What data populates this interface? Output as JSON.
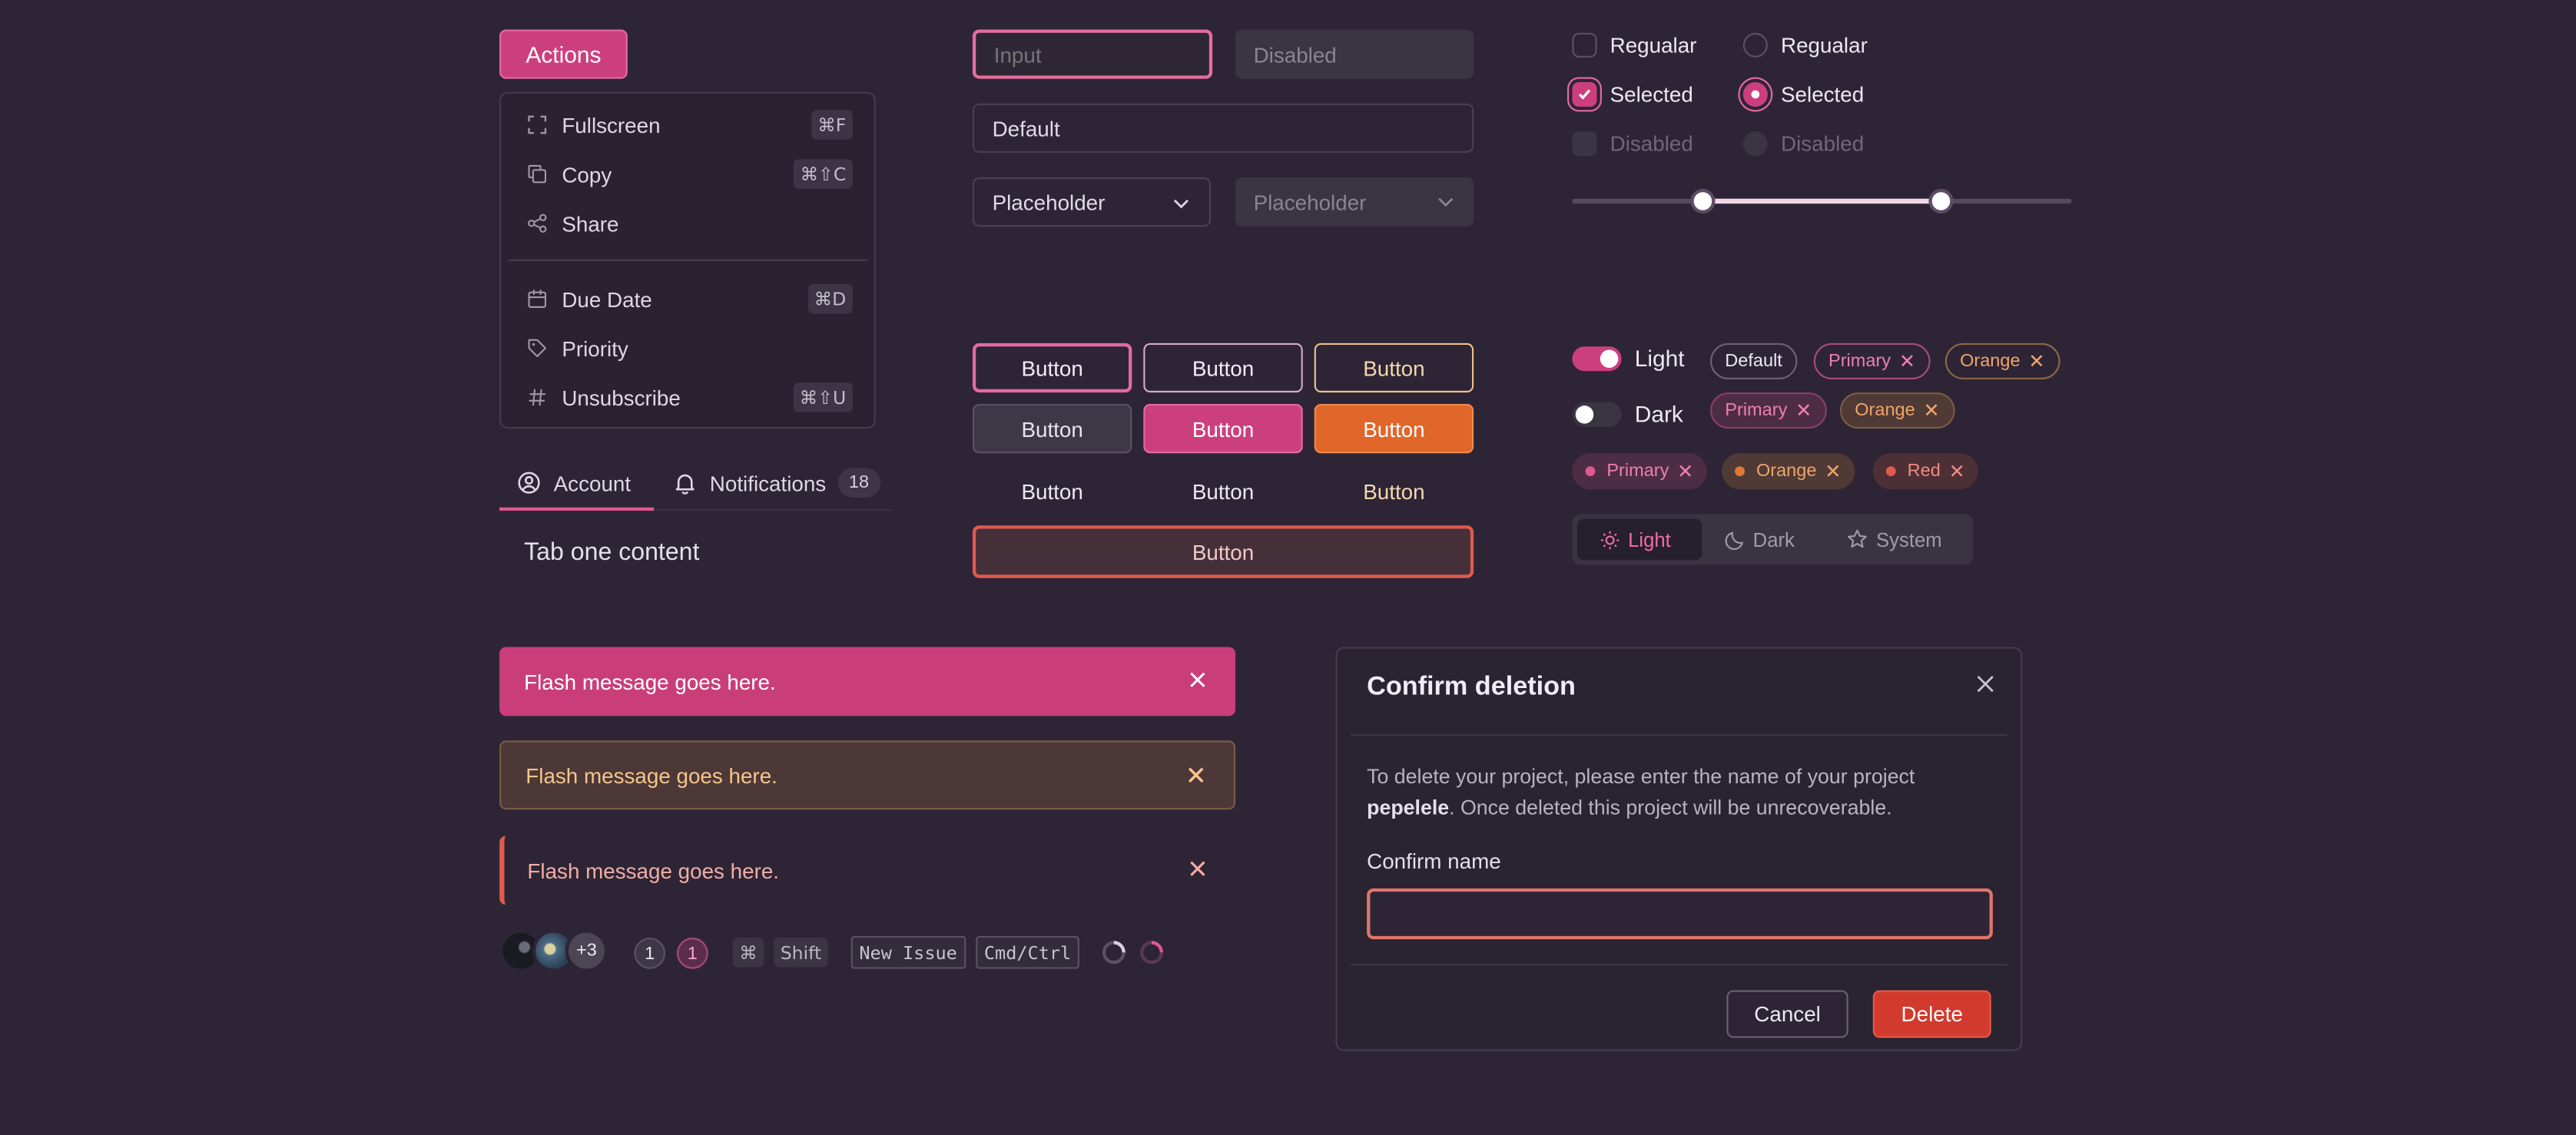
{
  "menu": {
    "trigger_label": "Actions",
    "items": [
      {
        "label": "Fullscreen",
        "icon": "expand-icon",
        "shortcut": "⌘F"
      },
      {
        "label": "Copy",
        "icon": "copy-icon",
        "shortcut": "⌘⇧C"
      },
      {
        "label": "Share",
        "icon": "share-icon",
        "shortcut": ""
      },
      {
        "label": "Due Date",
        "icon": "calendar-icon",
        "shortcut": "⌘D"
      },
      {
        "label": "Priority",
        "icon": "tag-icon",
        "shortcut": ""
      },
      {
        "label": "Unsubscribe",
        "icon": "hash-icon",
        "shortcut": "⌘⇧U"
      }
    ]
  },
  "tabs": {
    "items": [
      {
        "label": "Account",
        "icon": "user-circle-icon",
        "active": true
      },
      {
        "label": "Notifications",
        "icon": "bell-icon",
        "count": "18"
      }
    ],
    "content": "Tab one content"
  },
  "inputs": {
    "input_placeholder": "Input",
    "disabled_placeholder": "Disabled",
    "default_value": "Default",
    "select_placeholder": "Placeholder",
    "select_disabled_placeholder": "Placeholder"
  },
  "buttons": {
    "label": "Button"
  },
  "checkboxes": [
    {
      "label": "Regualar",
      "state": "unchecked"
    },
    {
      "label": "Selected",
      "state": "checked"
    },
    {
      "label": "Disabled",
      "state": "disabled"
    }
  ],
  "radios": [
    {
      "label": "Regualar",
      "state": "unchecked"
    },
    {
      "label": "Selected",
      "state": "checked"
    },
    {
      "label": "Disabled",
      "state": "disabled"
    }
  ],
  "slider": {
    "low": 0.26,
    "high": 0.74
  },
  "toggles": [
    {
      "label": "Light",
      "on": true
    },
    {
      "label": "Dark",
      "on": false
    }
  ],
  "tags_row1": [
    "Default",
    "Primary",
    "Orange"
  ],
  "tags_row2": [
    "Primary",
    "Orange"
  ],
  "tags_row3": [
    "Primary",
    "Orange",
    "Red"
  ],
  "theme_switch": {
    "options": [
      {
        "label": "Light",
        "icon": "sun-icon"
      },
      {
        "label": "Dark",
        "icon": "moon-icon"
      },
      {
        "label": "System",
        "icon": "star-icon"
      }
    ],
    "active": "Light"
  },
  "flash": {
    "messages": [
      "Flash message goes here.",
      "Flash message goes here.",
      "Flash message goes here."
    ]
  },
  "misc": {
    "avatar_overflow": "+3",
    "counters": [
      "1",
      "1"
    ],
    "keys": [
      "⌘",
      "Shift"
    ],
    "code": [
      "New Issue",
      "Cmd/Ctrl"
    ]
  },
  "dialog": {
    "title": "Confirm deletion",
    "text_before": "To delete your project, please enter the name of your project ",
    "project_name": "pepelele",
    "text_after": ". Once deleted this project will be unrecoverable.",
    "field_label": "Confirm name",
    "cancel_label": "Cancel",
    "delete_label": "Delete"
  },
  "colors": {
    "background": "#2d2535",
    "primary": "#cc3f7d",
    "orange": "#e0662a",
    "red": "#d13a2d"
  }
}
